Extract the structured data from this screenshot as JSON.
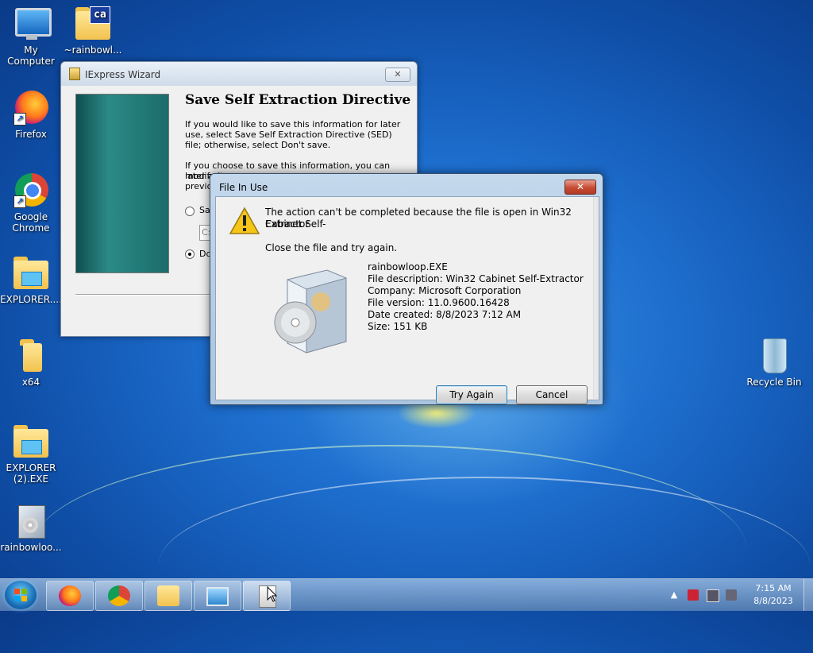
{
  "desktop": {
    "icons": [
      {
        "label": "My Computer"
      },
      {
        "label": "~rainbowl..."
      },
      {
        "label": "Firefox"
      },
      {
        "label": "Google Chrome"
      },
      {
        "label": "EXPLORER...."
      },
      {
        "label": "x64"
      },
      {
        "label": "EXPLORER (2).EXE"
      },
      {
        "label": "rainbowloo..."
      },
      {
        "label": "Recycle Bin"
      }
    ],
    "cab_badge": "ca"
  },
  "wizard": {
    "title": "IExpress Wizard",
    "close_label": "✕",
    "heading": "Save Self Extraction Directive",
    "paragraph1": "If you would like to save this information for later use, select Save Self Extraction Directive (SED) file; otherwise, select Don't save.",
    "paragraph2_partial": "If you choose to save this information, you can modify it",
    "line_later": "later an",
    "line_previous": "previou",
    "option_save_partial": "Sa",
    "field_partial": "C:",
    "option_dont_partial": "Do"
  },
  "dialog": {
    "title": "File In Use",
    "close_label": "✕",
    "message_line1": "The action can't be completed because the file is open in Win32 Cabinet Self-",
    "message_line2": "Extractor",
    "instruction": "Close the file and try again.",
    "file": {
      "name": "rainbowloop.EXE",
      "description": "File description: Win32 Cabinet Self-Extractor",
      "company": "Company: Microsoft Corporation",
      "version": "File version: 11.0.9600.16428",
      "created": "Date created: 8/8/2023 7:12 AM",
      "size": "Size: 151 KB"
    },
    "buttons": {
      "try_again": "Try Again",
      "cancel": "Cancel"
    }
  },
  "taskbar": {
    "clock_time": "7:15 AM",
    "clock_date": "8/8/2023",
    "tray_arrow": "▲"
  },
  "colors": {
    "desktop_blue": "#1e6fcf",
    "dialog_frame": "#a9c4df",
    "close_red": "#c74a32"
  }
}
